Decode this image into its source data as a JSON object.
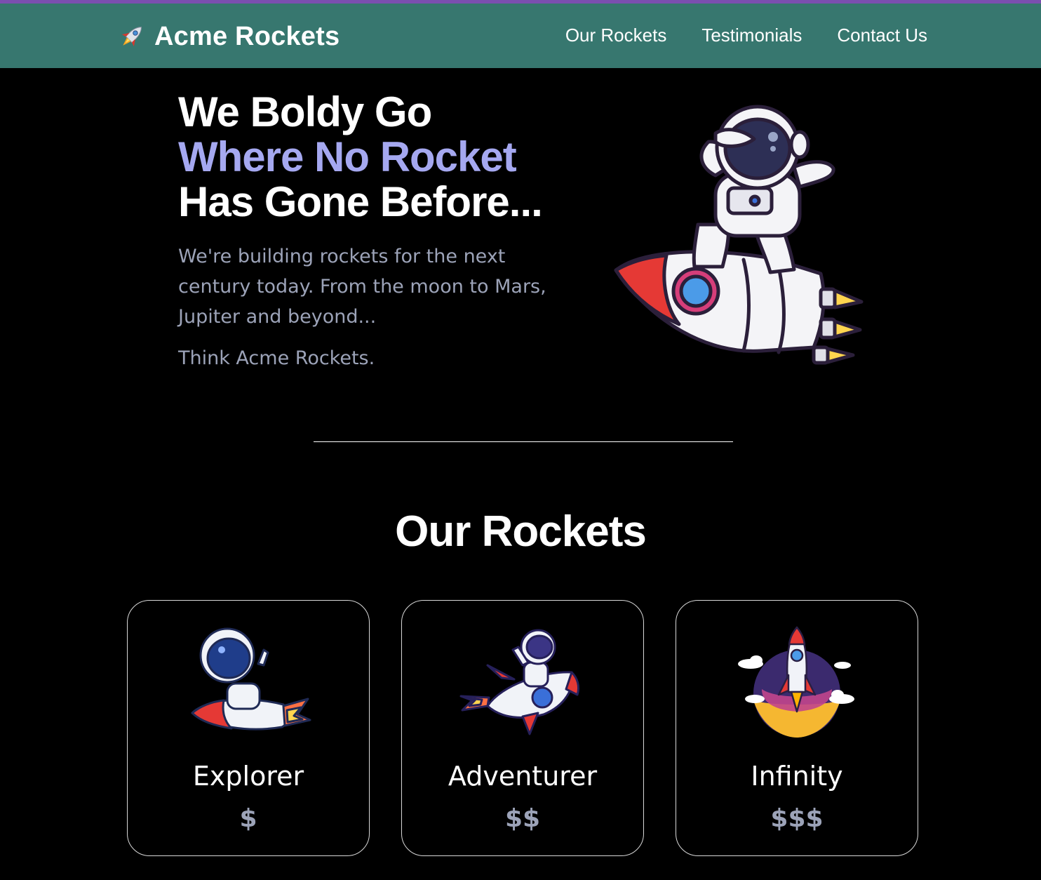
{
  "colors": {
    "header_bg": "#37776f",
    "top_stripe": "#7b4fb0",
    "accent_text": "#a5a8f0",
    "muted_text": "#9ca3b8",
    "page_bg": "#000000"
  },
  "header": {
    "brand_icon": "rocket-icon",
    "brand_name": "Acme Rockets",
    "nav": [
      {
        "label": "Our Rockets"
      },
      {
        "label": "Testimonials"
      },
      {
        "label": "Contact Us"
      }
    ]
  },
  "hero": {
    "title_line1": "We Boldy Go",
    "title_line2": "Where No Rocket",
    "title_line3": "Has Gone Before...",
    "copy": "We're building rockets for the next century today. From the moon to Mars, Jupiter and beyond...",
    "tagline": "Think Acme Rockets.",
    "image": "astronaut-on-rocket-illustration"
  },
  "rockets_section": {
    "title": "Our Rockets",
    "cards": [
      {
        "name": "Explorer",
        "price": "$",
        "image": "astronaut-riding-rocket-illustration"
      },
      {
        "name": "Adventurer",
        "price": "$$",
        "image": "astronaut-waving-on-rocket-illustration"
      },
      {
        "name": "Infinity",
        "price": "$$$",
        "image": "rocket-launch-illustration"
      }
    ]
  }
}
